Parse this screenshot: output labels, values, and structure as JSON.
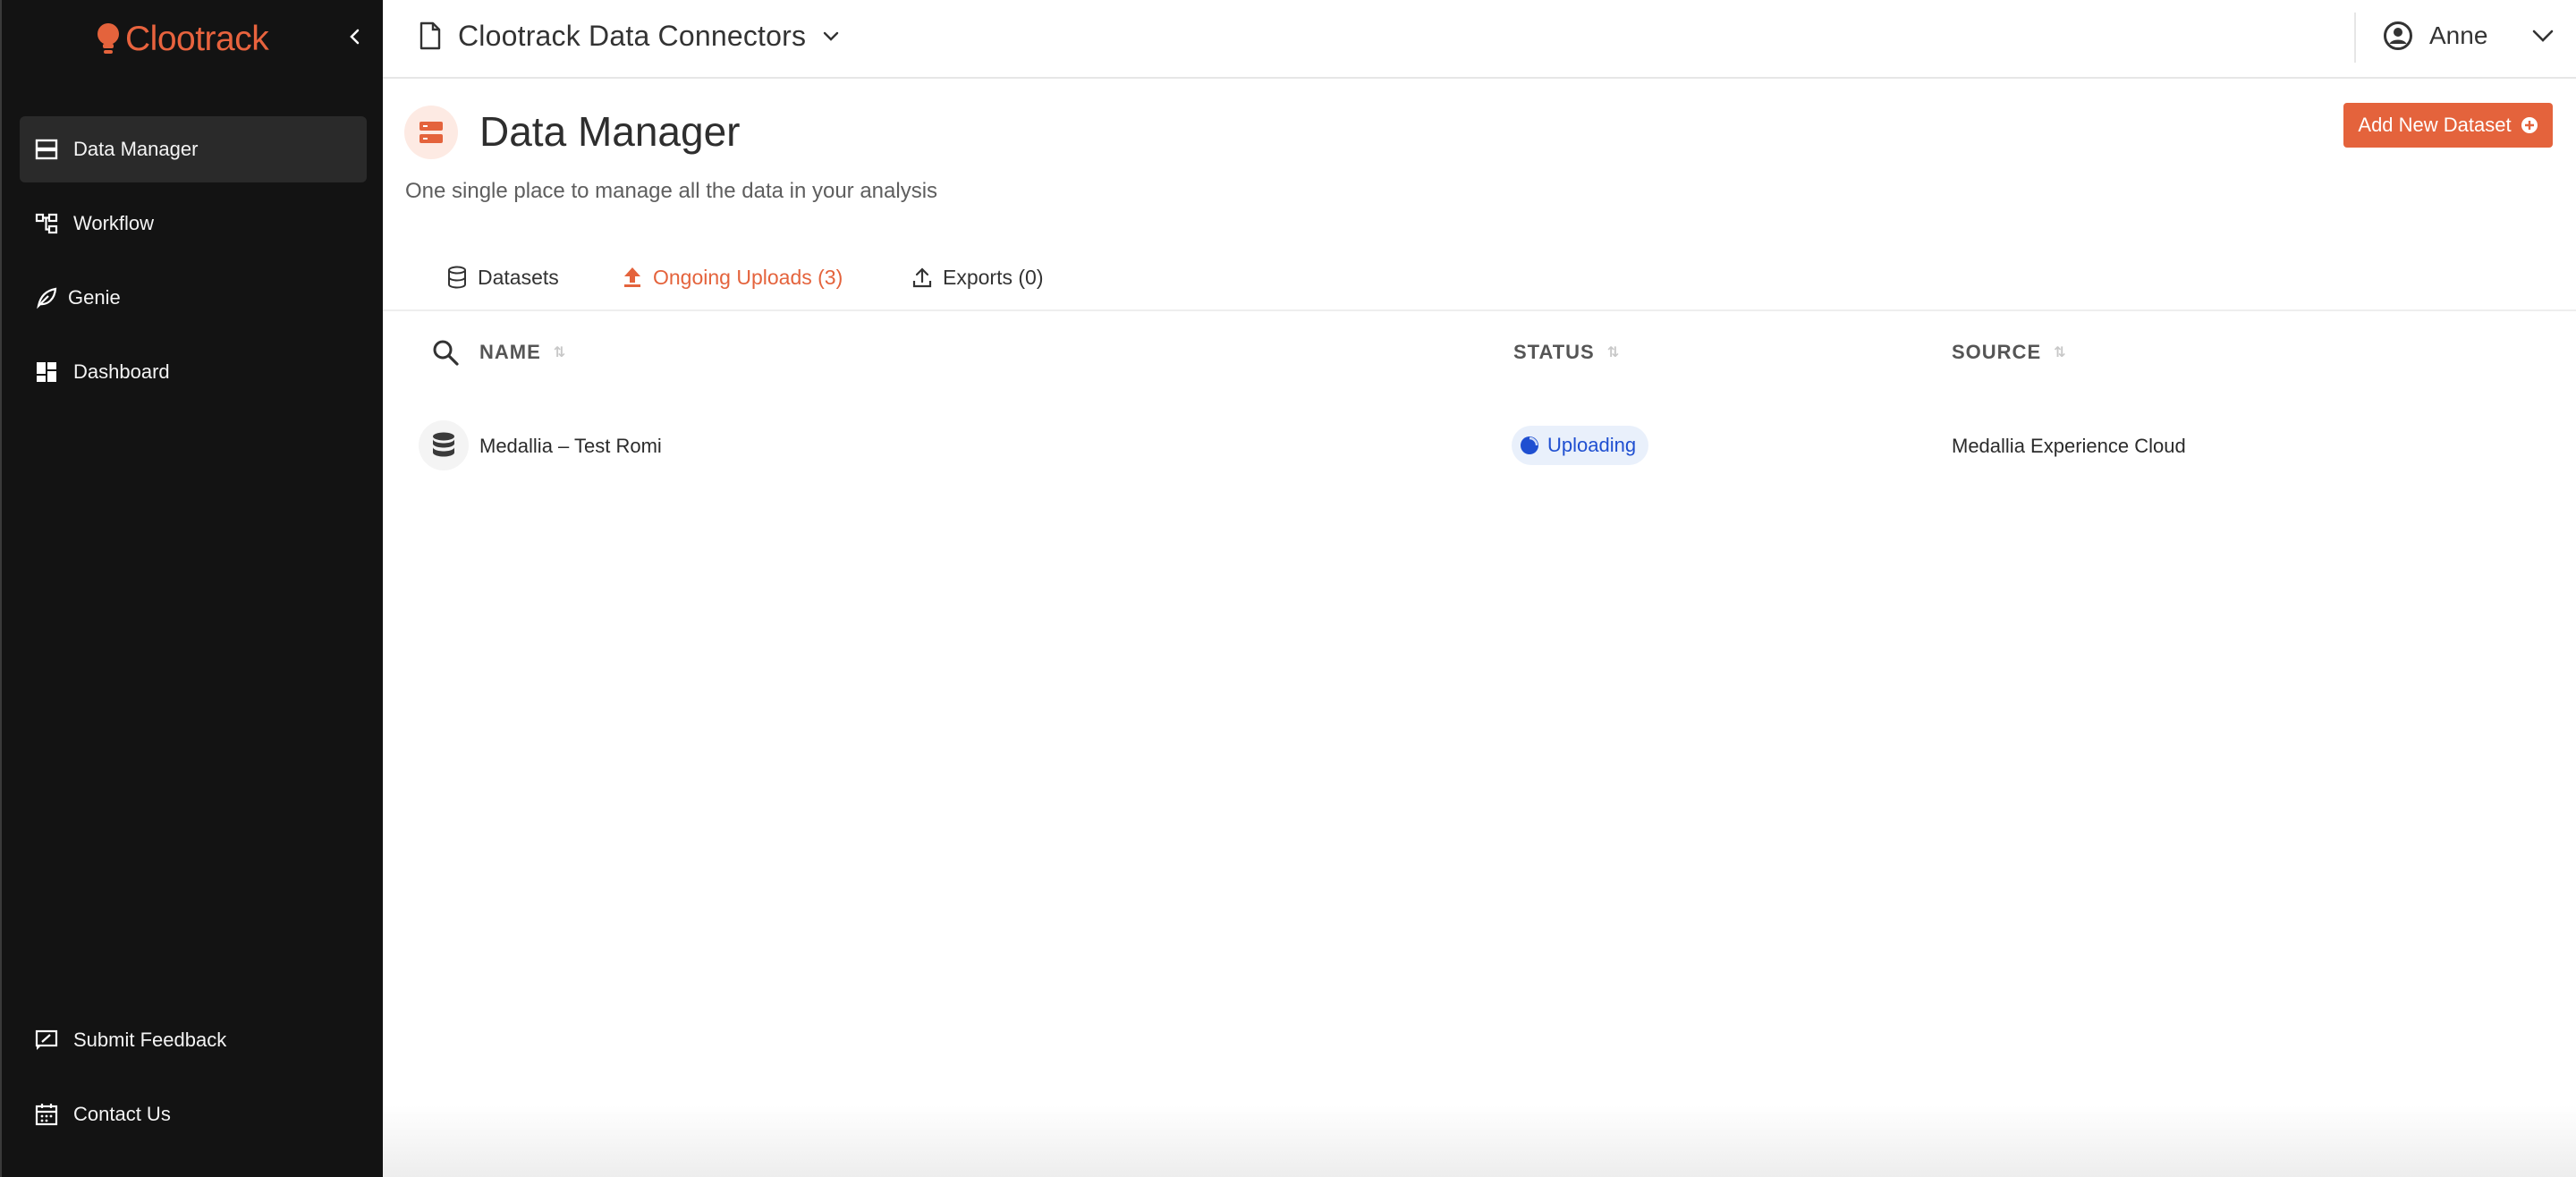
{
  "app": {
    "logo_text": "Clootrack",
    "brand_color": "#e4633c"
  },
  "sidebar": {
    "items": [
      {
        "label": "Data Manager",
        "icon": "data-manager-icon",
        "active": true
      },
      {
        "label": "Workflow",
        "icon": "workflow-icon",
        "active": false
      },
      {
        "label": "Genie",
        "icon": "genie-leaf-icon",
        "active": false
      },
      {
        "label": "Dashboard",
        "icon": "dashboard-icon",
        "active": false
      }
    ],
    "footer": [
      {
        "label": "Submit Feedback",
        "icon": "feedback-icon"
      },
      {
        "label": "Contact Us",
        "icon": "calendar-icon"
      }
    ]
  },
  "topbar": {
    "project_title": "Clootrack Data Connectors",
    "user_name": "Anne"
  },
  "header": {
    "title": "Data Manager",
    "subtitle": "One single place to manage all the data in your analysis",
    "add_button_label": "Add New Dataset"
  },
  "tabs": [
    {
      "label": "Datasets",
      "active": false
    },
    {
      "label": "Ongoing Uploads (3)",
      "active": true
    },
    {
      "label": "Exports (0)",
      "active": false
    }
  ],
  "table": {
    "columns": [
      "NAME",
      "STATUS",
      "SOURCE"
    ],
    "rows": [
      {
        "name": "Medallia – Test Romi",
        "status": "Uploading",
        "source": "Medallia Experience Cloud"
      }
    ]
  }
}
